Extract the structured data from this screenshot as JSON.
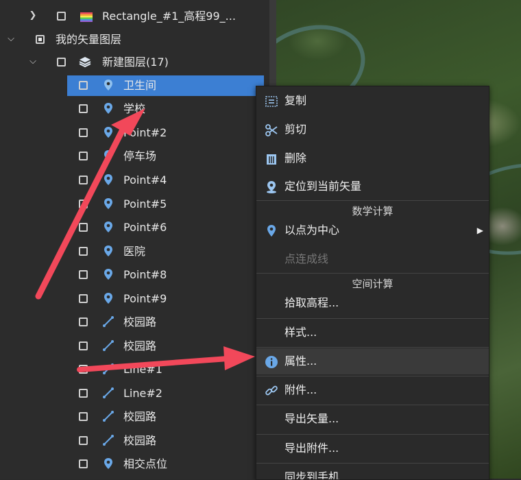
{
  "tree": {
    "rows": [
      {
        "label": "Rectangle_#1_高程99_...",
        "icon": "rainbow-raster-icon"
      },
      {
        "label": "我的矢量图层"
      },
      {
        "label": "新建图层(17)",
        "icon": "layers-icon"
      },
      {
        "label": "卫生间",
        "icon": "map-pin-icon"
      },
      {
        "label": "学校",
        "icon": "map-pin-icon"
      },
      {
        "label": "Point#2",
        "icon": "map-pin-icon"
      },
      {
        "label": "停车场",
        "icon": "map-pin-icon"
      },
      {
        "label": "Point#4",
        "icon": "map-pin-icon"
      },
      {
        "label": "Point#5",
        "icon": "map-pin-icon"
      },
      {
        "label": "Point#6",
        "icon": "map-pin-icon"
      },
      {
        "label": "医院",
        "icon": "map-pin-icon"
      },
      {
        "label": "Point#8",
        "icon": "map-pin-icon"
      },
      {
        "label": "Point#9",
        "icon": "map-pin-icon"
      },
      {
        "label": "校园路",
        "icon": "line-icon"
      },
      {
        "label": "校园路",
        "icon": "line-icon"
      },
      {
        "label": "Line#1",
        "icon": "line-icon"
      },
      {
        "label": "Line#2",
        "icon": "line-icon"
      },
      {
        "label": "校园路",
        "icon": "line-icon"
      },
      {
        "label": "校园路",
        "icon": "line-icon"
      },
      {
        "label": "相交点位",
        "icon": "map-pin-icon"
      }
    ]
  },
  "menu": {
    "copy": "复制",
    "cut": "剪切",
    "delete": "删除",
    "locate": "定位到当前矢量",
    "math_section": "数学计算",
    "center_on_point": "以点为中心",
    "points_to_line": "点连成线",
    "spatial_section": "空间计算",
    "pick_elevation": "拾取高程...",
    "style": "样式...",
    "properties": "属性...",
    "attachments": "附件...",
    "export_vector": "导出矢量...",
    "export_attachments": "导出附件...",
    "sync_phone": "同步到手机"
  },
  "colors": {
    "selection": "#3c7fd3",
    "arrow": "#f2485a",
    "pin": "#6aa8e8",
    "menu_bg": "#2a2a2a"
  }
}
